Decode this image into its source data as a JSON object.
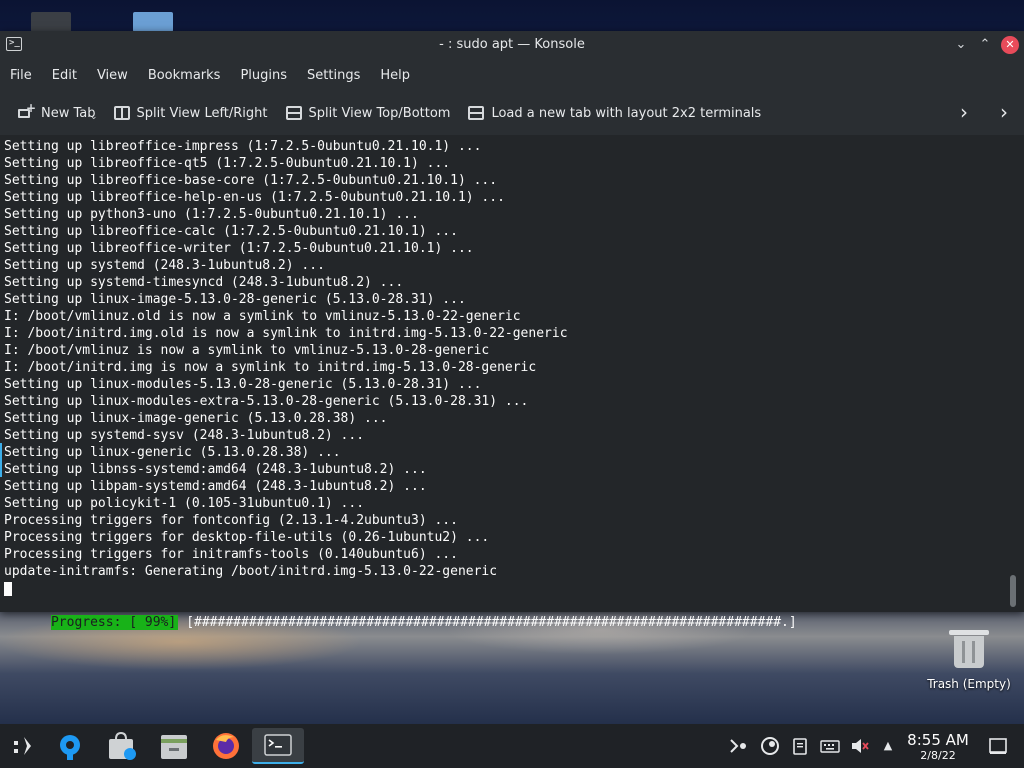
{
  "window": {
    "title": "- : sudo apt — Konsole",
    "app_icon_glyph": ">_",
    "minimize_glyph": "⌄",
    "maximize_glyph": "⌃",
    "close_glyph": "✕"
  },
  "menubar": {
    "items": [
      "File",
      "Edit",
      "View",
      "Bookmarks",
      "Plugins",
      "Settings",
      "Help"
    ]
  },
  "toolbar": {
    "new_tab": "New Tab",
    "split_lr": "Split View Left/Right",
    "split_tb": "Split View Top/Bottom",
    "load_layout": "Load a new tab with layout 2x2 terminals",
    "chevron": "›"
  },
  "terminal": {
    "lines": [
      "Setting up libreoffice-impress (1:7.2.5-0ubuntu0.21.10.1) ...",
      "Setting up libreoffice-qt5 (1:7.2.5-0ubuntu0.21.10.1) ...",
      "Setting up libreoffice-base-core (1:7.2.5-0ubuntu0.21.10.1) ...",
      "Setting up libreoffice-help-en-us (1:7.2.5-0ubuntu0.21.10.1) ...",
      "Setting up python3-uno (1:7.2.5-0ubuntu0.21.10.1) ...",
      "Setting up libreoffice-calc (1:7.2.5-0ubuntu0.21.10.1) ...",
      "Setting up libreoffice-writer (1:7.2.5-0ubuntu0.21.10.1) ...",
      "Setting up systemd (248.3-1ubuntu8.2) ...",
      "Setting up systemd-timesyncd (248.3-1ubuntu8.2) ...",
      "Setting up linux-image-5.13.0-28-generic (5.13.0-28.31) ...",
      "I: /boot/vmlinuz.old is now a symlink to vmlinuz-5.13.0-22-generic",
      "I: /boot/initrd.img.old is now a symlink to initrd.img-5.13.0-22-generic",
      "I: /boot/vmlinuz is now a symlink to vmlinuz-5.13.0-28-generic",
      "I: /boot/initrd.img is now a symlink to initrd.img-5.13.0-28-generic",
      "Setting up linux-modules-5.13.0-28-generic (5.13.0-28.31) ...",
      "Setting up linux-modules-extra-5.13.0-28-generic (5.13.0-28.31) ...",
      "Setting up linux-image-generic (5.13.0.28.38) ...",
      "Setting up systemd-sysv (248.3-1ubuntu8.2) ...",
      "Setting up linux-generic (5.13.0.28.38) ...",
      "Setting up libnss-systemd:amd64 (248.3-1ubuntu8.2) ...",
      "Setting up libpam-systemd:amd64 (248.3-1ubuntu8.2) ...",
      "Setting up policykit-1 (0.105-31ubuntu0.1) ...",
      "Processing triggers for fontconfig (2.13.1-4.2ubuntu3) ...",
      "Processing triggers for desktop-file-utils (0.26-1ubuntu2) ...",
      "Processing triggers for initramfs-tools (0.140ubuntu6) ...",
      "update-initramfs: Generating /boot/initrd.img-5.13.0-22-generic"
    ],
    "progress_label": "Progress: [ 99%]",
    "progress_bar": "[###########################################################################.]",
    "progress_percent": 99
  },
  "desktop": {
    "trash_label": "Trash (Empty)"
  },
  "taskbar": {
    "clock_time": "8:55 AM",
    "clock_date": "2/8/22",
    "tray_expand_glyph": "▲"
  },
  "colors": {
    "accent": "#3daee9",
    "progress_green": "#18b218",
    "close_red": "#e84b5a",
    "terminal_bg": "#232629"
  }
}
